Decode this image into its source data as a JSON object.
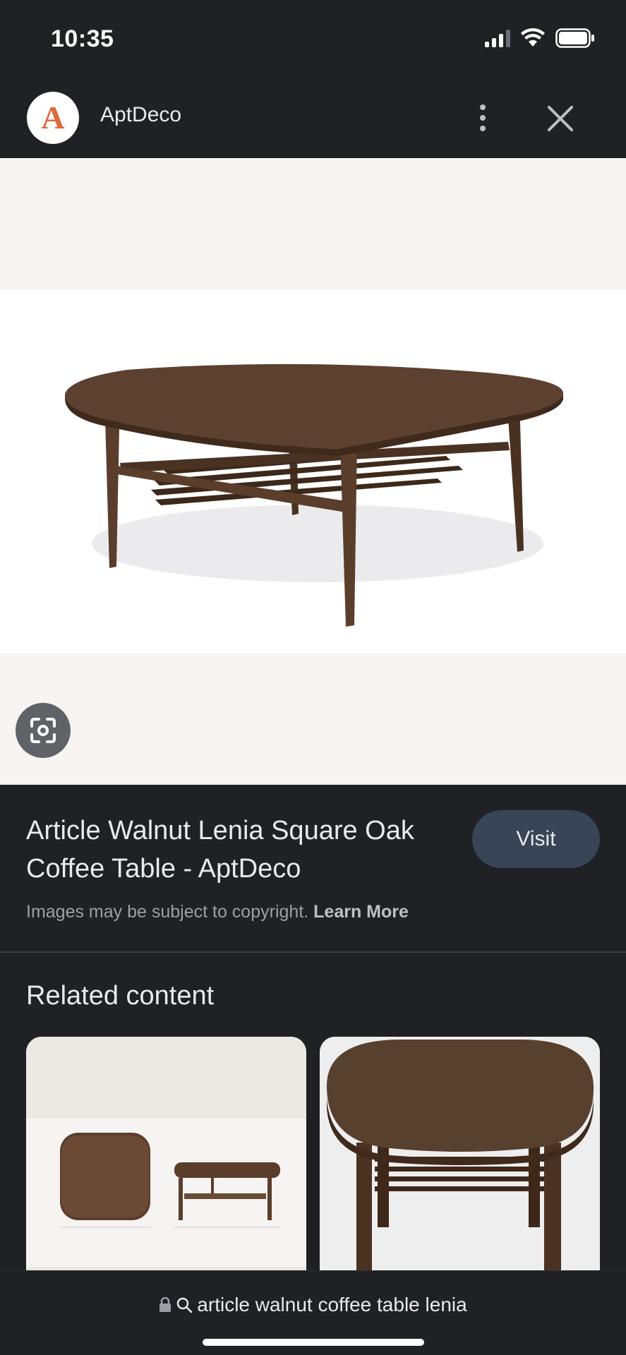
{
  "status_bar": {
    "time": "10:35"
  },
  "top_bar": {
    "site_logo_letter": "A",
    "site_name": "AptDeco"
  },
  "item": {
    "title": "Article Walnut Lenia Square Oak Coffee Table - AptDeco",
    "visit_label": "Visit",
    "copyright_text": "Images may be subject to copyright.",
    "learn_more_label": "Learn More"
  },
  "related": {
    "heading": "Related content"
  },
  "bottom_bar": {
    "url_text": "article walnut coffee table lenia"
  },
  "colors": {
    "background": "#202124",
    "visit_button": "#394457",
    "logo_accent": "#e0683a",
    "walnut": "#5a3e2b"
  }
}
